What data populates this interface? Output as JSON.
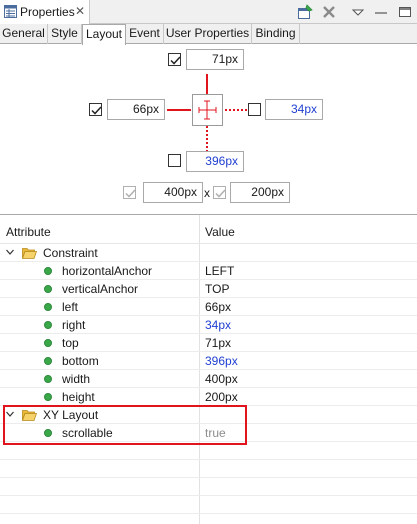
{
  "view": {
    "title": "Properties",
    "close_glyph": "✕",
    "toolbar": [
      "pin-editor-icon",
      "remove-icon",
      "view-menu-icon",
      "minimize-icon"
    ]
  },
  "tabs": [
    {
      "label": "General",
      "active": false
    },
    {
      "label": "Style",
      "active": false
    },
    {
      "label": "Layout",
      "active": true
    },
    {
      "label": "Event",
      "active": false
    },
    {
      "label": "User Properties",
      "active": false
    },
    {
      "label": "Binding",
      "active": false
    }
  ],
  "layout_editor": {
    "top": {
      "checked": true,
      "value": "71px"
    },
    "left": {
      "checked": true,
      "value": "66px"
    },
    "right": {
      "checked": false,
      "value": "34px"
    },
    "bottom": {
      "checked": false,
      "value": "396px"
    },
    "width": {
      "checked": true,
      "enabled": false,
      "value": "400px"
    },
    "height": {
      "checked": true,
      "enabled": false,
      "value": "200px"
    },
    "size_separator": "x"
  },
  "table": {
    "headers": {
      "attribute": "Attribute",
      "value": "Value"
    },
    "groups": [
      {
        "name": "Constraint",
        "expanded": true,
        "rows": [
          {
            "attr": "horizontalAnchor",
            "value": "LEFT",
            "style": "normal"
          },
          {
            "attr": "verticalAnchor",
            "value": "TOP",
            "style": "normal"
          },
          {
            "attr": "left",
            "value": "66px",
            "style": "normal"
          },
          {
            "attr": "right",
            "value": "34px",
            "style": "blue"
          },
          {
            "attr": "top",
            "value": "71px",
            "style": "normal"
          },
          {
            "attr": "bottom",
            "value": "396px",
            "style": "blue"
          },
          {
            "attr": "width",
            "value": "400px",
            "style": "normal"
          },
          {
            "attr": "height",
            "value": "200px",
            "style": "normal"
          }
        ]
      },
      {
        "name": "XY Layout",
        "expanded": true,
        "rows": [
          {
            "attr": "scrollable",
            "value": "true",
            "style": "gray"
          }
        ]
      }
    ]
  },
  "colors": {
    "accent_red": "#e0141c",
    "link_blue": "#1f3fd1",
    "dot_green": "#3aa84a",
    "folder_yellow": "#f2c84b"
  }
}
